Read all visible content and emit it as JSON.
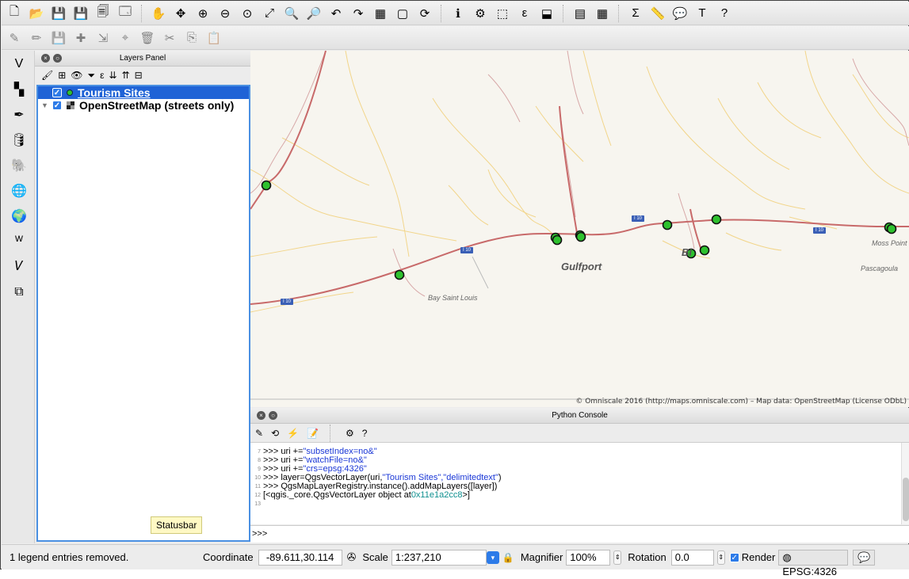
{
  "toolbar_primary": [
    {
      "name": "new-project-icon",
      "glyph": "🗋"
    },
    {
      "name": "open-project-icon",
      "glyph": "📂"
    },
    {
      "name": "save-project-icon",
      "glyph": "💾"
    },
    {
      "name": "save-as-icon",
      "glyph": "💾"
    },
    {
      "name": "new-print-composer-icon",
      "glyph": "🗐"
    },
    {
      "name": "composer-manager-icon",
      "glyph": "🗔"
    },
    {
      "name": "pan-map-icon",
      "glyph": "✋"
    },
    {
      "name": "pan-to-selection-icon",
      "glyph": "✥"
    },
    {
      "name": "zoom-in-icon",
      "glyph": "⊕"
    },
    {
      "name": "zoom-out-icon",
      "glyph": "⊖"
    },
    {
      "name": "zoom-actual-size-icon",
      "glyph": "⊙"
    },
    {
      "name": "zoom-full-icon",
      "glyph": "⤢"
    },
    {
      "name": "zoom-to-selection-icon",
      "glyph": "🔍"
    },
    {
      "name": "zoom-to-layer-icon",
      "glyph": "🔎"
    },
    {
      "name": "zoom-last-icon",
      "glyph": "↶"
    },
    {
      "name": "zoom-next-icon",
      "glyph": "↷"
    },
    {
      "name": "new-map-view-icon",
      "glyph": "▦"
    },
    {
      "name": "new-bookmark-icon",
      "glyph": "▢"
    },
    {
      "name": "refresh-icon",
      "glyph": "⟳"
    },
    {
      "name": "identify-features-icon",
      "glyph": "ℹ"
    },
    {
      "name": "run-feature-action-icon",
      "glyph": "⚙"
    },
    {
      "name": "select-features-icon",
      "glyph": "⬚"
    },
    {
      "name": "select-by-expression-icon",
      "glyph": "ε"
    },
    {
      "name": "deselect-features-icon",
      "glyph": "⬓"
    },
    {
      "name": "open-attribute-table-icon",
      "glyph": "▤"
    },
    {
      "name": "open-field-calculator-icon",
      "glyph": "▦"
    },
    {
      "name": "statistical-summary-icon",
      "glyph": "Σ"
    },
    {
      "name": "measure-line-icon",
      "glyph": "📏"
    },
    {
      "name": "map-tips-icon",
      "glyph": "💬"
    },
    {
      "name": "text-annotation-icon",
      "glyph": "T"
    },
    {
      "name": "help-contents-icon",
      "glyph": "?"
    }
  ],
  "toolbar_edit": [
    {
      "name": "current-edits-icon",
      "glyph": "✎"
    },
    {
      "name": "toggle-editing-icon",
      "glyph": "✏"
    },
    {
      "name": "save-layer-edits-icon",
      "glyph": "💾"
    },
    {
      "name": "add-feature-icon",
      "glyph": "✚"
    },
    {
      "name": "move-feature-icon",
      "glyph": "⇲"
    },
    {
      "name": "node-tool-icon",
      "glyph": "⌖"
    },
    {
      "name": "delete-selected-icon",
      "glyph": "🗑"
    },
    {
      "name": "cut-features-icon",
      "glyph": "✂"
    },
    {
      "name": "copy-features-icon",
      "glyph": "⎘"
    },
    {
      "name": "paste-features-icon",
      "glyph": "📋"
    }
  ],
  "left_tools": [
    {
      "name": "add-vector-layer-icon",
      "glyph": "V"
    },
    {
      "name": "add-raster-layer-icon",
      "glyph": "▚"
    },
    {
      "name": "add-delimited-text-layer-icon",
      "glyph": "✒"
    },
    {
      "name": "add-spatialite-layer-icon",
      "glyph": "🛢"
    },
    {
      "name": "add-postgis-layer-icon",
      "glyph": "🐘"
    },
    {
      "name": "add-wms-layer-icon",
      "glyph": "🌐"
    },
    {
      "name": "add-wcs-layer-icon",
      "glyph": "🌍"
    },
    {
      "name": "add-wfs-layer-icon",
      "glyph": "ᵂ"
    },
    {
      "name": "new-shapefile-layer-icon",
      "glyph": "𝑉"
    },
    {
      "name": "add-virtual-layer-icon",
      "glyph": "⧉"
    }
  ],
  "layers_panel": {
    "title": "Layers Panel",
    "tools": [
      {
        "name": "open-layer-styling-icon",
        "glyph": "🖌"
      },
      {
        "name": "add-group-icon",
        "glyph": "⊞"
      },
      {
        "name": "manage-visibility-icon",
        "glyph": "👁"
      },
      {
        "name": "filter-legend-icon",
        "glyph": "⏷"
      },
      {
        "name": "filter-by-expression-icon",
        "glyph": "ε"
      },
      {
        "name": "expand-all-icon",
        "glyph": "⇊"
      },
      {
        "name": "collapse-all-icon",
        "glyph": "⇈"
      },
      {
        "name": "remove-layer-icon",
        "glyph": "⊟"
      }
    ],
    "layers": [
      {
        "name": "Tourism Sites",
        "checked": true,
        "selected": true,
        "kind": "point"
      },
      {
        "name": "OpenStreetMap (streets only)",
        "checked": true,
        "selected": false,
        "kind": "tile"
      }
    ],
    "tooltip": "Statusbar"
  },
  "map": {
    "attribution": "© Omniscale 2016 (http://maps.omniscale.com) – Map data: OpenStreetMap (License ODbL)",
    "labels": [
      {
        "text": "Gulfport",
        "kind": "big"
      },
      {
        "text": "Bay Saint Louis",
        "kind": "small"
      },
      {
        "text": "Pascagoula",
        "kind": "small"
      },
      {
        "text": "Moss Point",
        "kind": "small"
      },
      {
        "text": "Bi",
        "kind": "big"
      }
    ],
    "shields": [
      "I 10",
      "I 10",
      "I 10",
      "I 10"
    ],
    "point_color": "#2ec12e"
  },
  "python_console": {
    "title": "Python Console",
    "tools": [
      {
        "name": "clear-console-icon",
        "glyph": "✎"
      },
      {
        "name": "import-class-icon",
        "glyph": "⟲"
      },
      {
        "name": "run-command-icon",
        "glyph": "⚡"
      },
      {
        "name": "show-editor-icon",
        "glyph": "📝"
      },
      {
        "name": "settings-icon",
        "glyph": "⚙"
      },
      {
        "name": "help-icon",
        "glyph": "?"
      }
    ],
    "lines": [
      {
        "n": "7",
        "pre": ">>> uri += ",
        "str": "\"subsetIndex=no&\"",
        "post": ""
      },
      {
        "n": "8",
        "pre": ">>> uri += ",
        "str": "\"watchFile=no&\"",
        "post": ""
      },
      {
        "n": "9",
        "pre": ">>> uri += ",
        "str": "\"crs=epsg:4326\"",
        "post": ""
      },
      {
        "n": "10",
        "pre": ">>> layer=QgsVectorLayer(uri,",
        "str": "\"Tourism Sites\",\"delimitedtext\"",
        "post": ")"
      },
      {
        "n": "11",
        "pre": ">>> QgsMapLayerRegistry.instance().addMapLayers([layer])",
        "str": "",
        "post": ""
      },
      {
        "n": "12",
        "pre": "[<qgis._core.QgsVectorLayer object at ",
        "str": "",
        "hex": "0x11e1a2cc8",
        "post": ">]"
      },
      {
        "n": "13",
        "pre": "",
        "str": "",
        "post": ""
      }
    ],
    "prompt": ">>>"
  },
  "statusbar": {
    "message": "1 legend entries removed.",
    "coordinate_label": "Coordinate",
    "coordinate_value": "-89.611,30.114",
    "scale_label": "Scale",
    "scale_value": "1:237,210",
    "magnifier_label": "Magnifier",
    "magnifier_value": "100%",
    "rotation_label": "Rotation",
    "rotation_value": "0.0",
    "render_label": "Render",
    "crs_label": "EPSG:4326"
  }
}
